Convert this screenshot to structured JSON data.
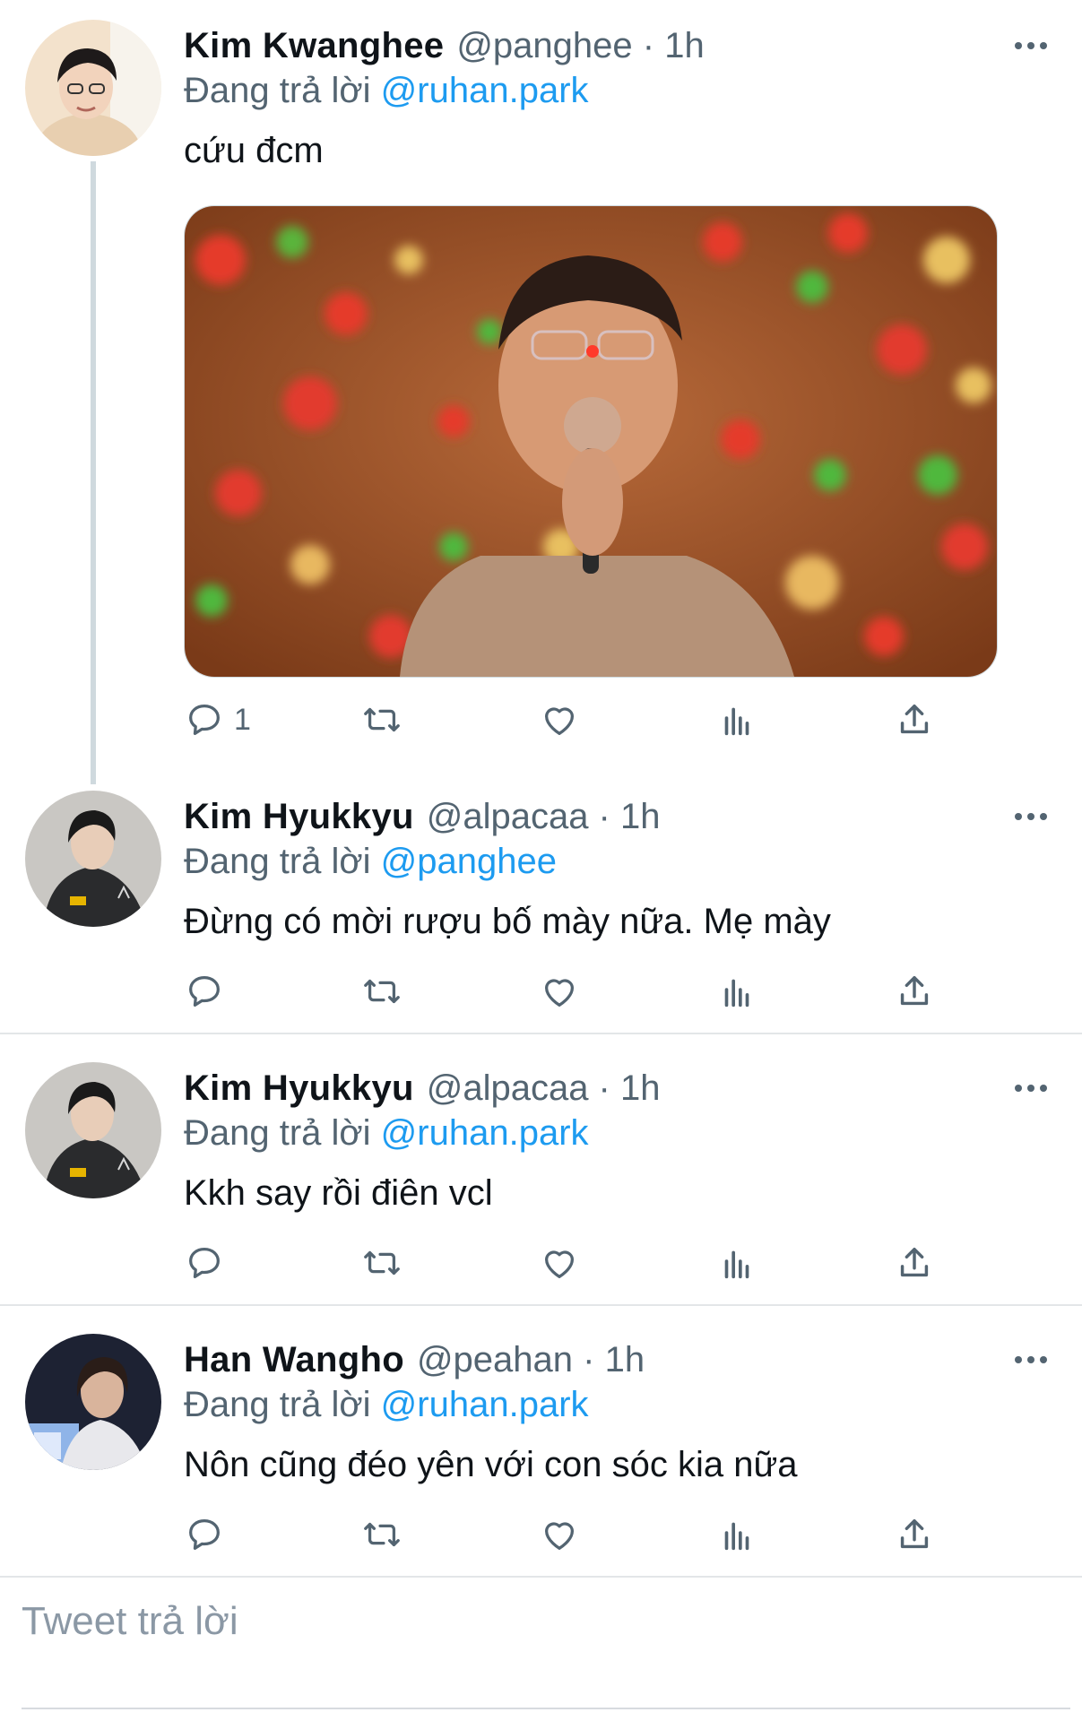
{
  "tweets": [
    {
      "name": "Kim Kwanghee",
      "handle": "@panghee · 1h",
      "replying_prefix": "Đang trả lời",
      "replying_to": "@ruhan.park",
      "text": "cứu đcm",
      "reply_count": "1",
      "avatar": "avatar-photo"
    },
    {
      "name": "Kim Hyukkyu",
      "handle": "@alpacaa · 1h",
      "replying_prefix": "Đang trả lời",
      "replying_to": "@panghee",
      "text": "Đừng có mời rượu bố mày nữa. Mẹ mày",
      "reply_count": "",
      "avatar": "avatar-photo"
    },
    {
      "name": "Kim Hyukkyu",
      "handle": "@alpacaa · 1h",
      "replying_prefix": "Đang trả lời",
      "replying_to": "@ruhan.park",
      "text": "Kkh say rồi điên vcl",
      "reply_count": "",
      "avatar": "avatar-photo"
    },
    {
      "name": "Han Wangho",
      "handle": "@peahan · 1h",
      "replying_prefix": "Đang trả lời",
      "replying_to": "@ruhan.park",
      "text": "Nôn cũng đéo yên với con sóc kia nữa",
      "reply_count": "",
      "avatar": "avatar-photo"
    }
  ],
  "composer": {
    "placeholder": "Tweet trả lời"
  },
  "icons": [
    "reply-icon",
    "retweet-icon",
    "like-icon",
    "analytics-icon",
    "share-icon",
    "more-icon"
  ],
  "colors": {
    "link": "#1d9bf0",
    "secondary": "#536471",
    "text": "#0f1419",
    "divider": "#e3e6e8"
  }
}
